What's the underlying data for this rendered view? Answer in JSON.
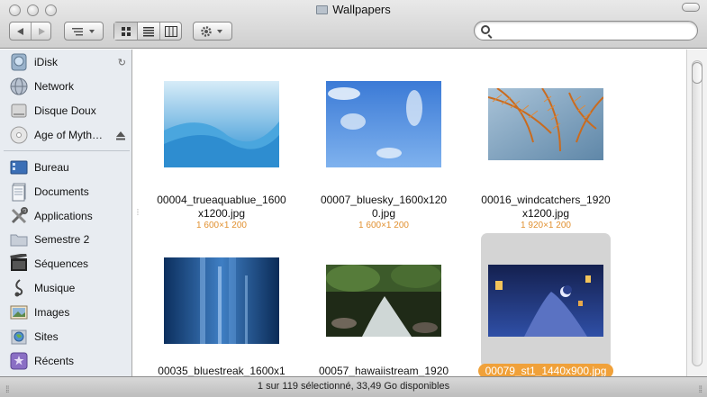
{
  "window": {
    "title": "Wallpapers"
  },
  "toolbar": {
    "back_icon": "back-arrow-icon",
    "forward_icon": "forward-arrow-icon",
    "arrange_icon": "arrange-lines-icon",
    "views": [
      "icon-view",
      "list-view",
      "column-view"
    ],
    "action_icon": "gear-icon",
    "search_placeholder": ""
  },
  "sidebar": {
    "devices": [
      {
        "label": "iDisk",
        "icon": "idisk-icon"
      },
      {
        "label": "Network",
        "icon": "network-globe-icon"
      },
      {
        "label": "Disque Doux",
        "icon": "hard-disk-icon"
      },
      {
        "label": "Age of Myth…",
        "icon": "cd-disc-icon"
      }
    ],
    "places": [
      {
        "label": "Bureau",
        "icon": "desktop-icon"
      },
      {
        "label": "Documents",
        "icon": "documents-icon"
      },
      {
        "label": "Applications",
        "icon": "applications-icon"
      },
      {
        "label": "Semestre 2",
        "icon": "folder-icon"
      },
      {
        "label": "Séquences",
        "icon": "movies-icon"
      },
      {
        "label": "Musique",
        "icon": "music-icon"
      },
      {
        "label": "Images",
        "icon": "pictures-icon"
      },
      {
        "label": "Sites",
        "icon": "sites-icon"
      },
      {
        "label": "Récents",
        "icon": "recents-icon"
      }
    ]
  },
  "files": [
    {
      "name_line1": "00004_trueaquablue_1600",
      "name_line2": "x1200.jpg",
      "size": "1 600×1 200",
      "selected": false
    },
    {
      "name_line1": "00007_bluesky_1600x120",
      "name_line2": "0.jpg",
      "size": "1 600×1 200",
      "selected": false
    },
    {
      "name_line1": "00016_windcatchers_1920",
      "name_line2": "x1200.jpg",
      "size": "1 920×1 200",
      "selected": false
    },
    {
      "name_line1": "00035_bluestreak_1600x1",
      "name_line2": "",
      "size": "",
      "selected": false
    },
    {
      "name_line1": "00057_hawaiistream_1920",
      "name_line2": "",
      "size": "",
      "selected": false
    },
    {
      "name_line1": "00079_st1_1440x900.jpg",
      "name_line2": "",
      "size": "",
      "selected": true
    }
  ],
  "status": {
    "text": "1 sur 119 sélectionné, 33,49 Go disponibles"
  },
  "colors": {
    "selection": "#f0a13a",
    "dimensions": "#e1902f",
    "sidebar_bg": "#e8ecf1"
  }
}
